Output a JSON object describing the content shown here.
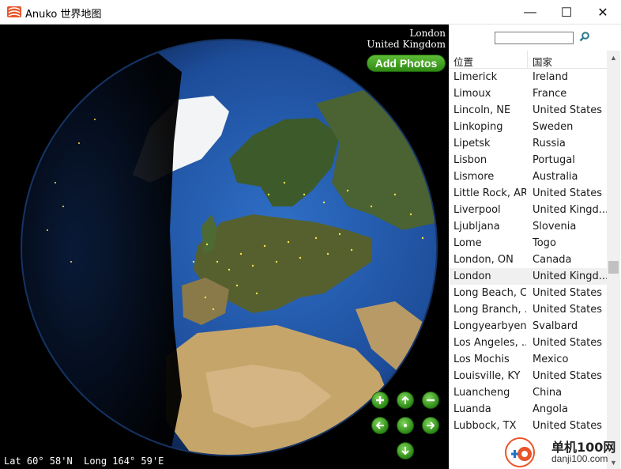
{
  "window": {
    "title": "Anuko 世界地图",
    "min_glyph": "—",
    "max_glyph": "☐",
    "close_glyph": "✕"
  },
  "globe": {
    "location_city": "London",
    "location_country": "United Kingdom",
    "add_photos_label": "Add Photos",
    "coords_text": "Lat 60° 58'N  Long 164° 59'E",
    "nav_icons": [
      "zoom-in-icon",
      "arrow-up-icon",
      "zoom-out-icon",
      "arrow-left-icon",
      "center-icon",
      "arrow-right-icon",
      "arrow-down-icon"
    ]
  },
  "search": {
    "value": "",
    "icon": "magnifier-icon"
  },
  "list": {
    "col_location": "位置",
    "col_country": "国家",
    "rows": [
      {
        "location": "Limerick",
        "country": "Ireland"
      },
      {
        "location": "Limoux",
        "country": "France"
      },
      {
        "location": "Lincoln, NE",
        "country": "United States"
      },
      {
        "location": "Linkoping",
        "country": "Sweden"
      },
      {
        "location": "Lipetsk",
        "country": "Russia"
      },
      {
        "location": "Lisbon",
        "country": "Portugal"
      },
      {
        "location": "Lismore",
        "country": "Australia"
      },
      {
        "location": "Little Rock, AR",
        "country": "United States"
      },
      {
        "location": "Liverpool",
        "country": "United Kingd..."
      },
      {
        "location": "Ljubljana",
        "country": "Slovenia"
      },
      {
        "location": "Lome",
        "country": "Togo"
      },
      {
        "location": "London, ON",
        "country": "Canada"
      },
      {
        "location": "London",
        "country": "United Kingd...",
        "selected": true
      },
      {
        "location": "Long Beach, CA",
        "country": "United States"
      },
      {
        "location": "Long Branch, ...",
        "country": "United States"
      },
      {
        "location": "Longyearbyen",
        "country": "Svalbard"
      },
      {
        "location": "Los Angeles, ...",
        "country": "United States"
      },
      {
        "location": "Los Mochis",
        "country": "Mexico"
      },
      {
        "location": "Louisville, KY",
        "country": "United States"
      },
      {
        "location": "Luancheng",
        "country": "China"
      },
      {
        "location": "Luanda",
        "country": "Angola"
      },
      {
        "location": "Lubbock, TX",
        "country": "United States"
      }
    ],
    "scroll_position": 0.52
  },
  "watermark": {
    "line1": "单机100网",
    "line2": "danji100.com"
  },
  "colors": {
    "accent_green": "#3a9a1e",
    "selected_row": "#f0f0f0"
  }
}
